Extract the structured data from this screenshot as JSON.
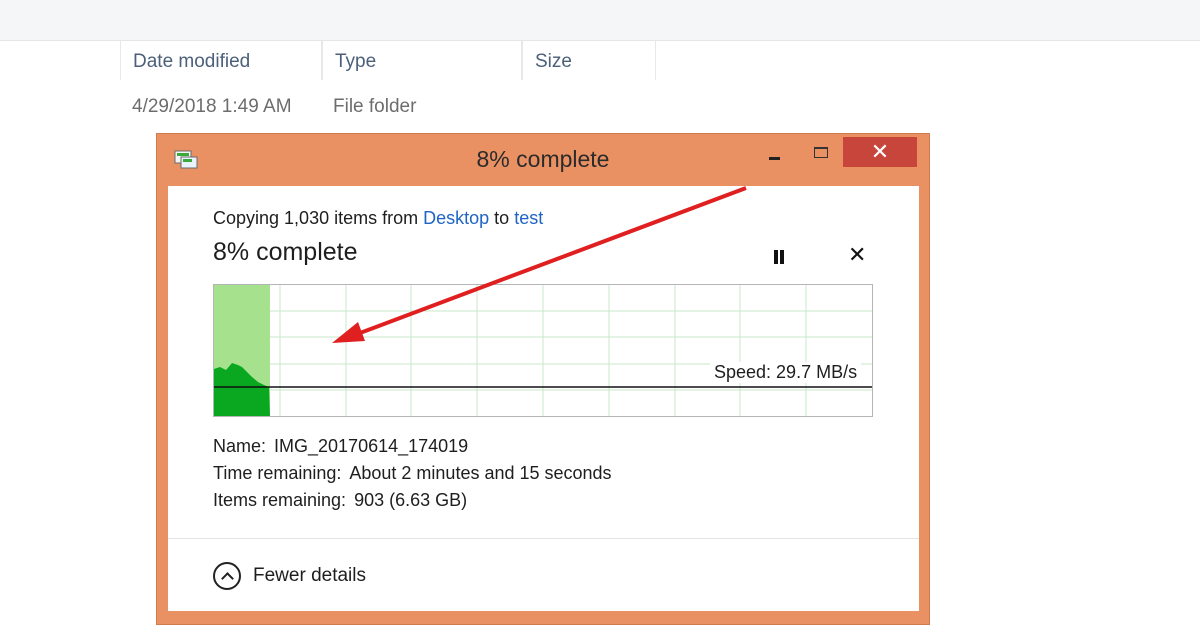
{
  "explorer": {
    "columns": [
      "Date modified",
      "Type",
      "Size"
    ],
    "row": {
      "date": "4/29/2018 1:49 AM",
      "type": "File folder",
      "size": ""
    }
  },
  "dialog": {
    "title": "8% complete",
    "minimize_icon": "minimize-icon",
    "maximize_icon": "maximize-icon",
    "close_icon": "close-icon",
    "close_label": "✕",
    "copy_prefix": "Copying 1,030 items from",
    "source": "Desktop",
    "to_word": "to",
    "destination": "test",
    "heading": "8% complete",
    "progress_fraction": 0.08,
    "speed": "Speed: 29.7 MB/s",
    "cancel_label": "✕",
    "name_label": "Name:",
    "name_value": "IMG_20170614_174019",
    "time_label": "Time remaining:",
    "time_value": "About 2 minutes and 15 seconds",
    "items_label": "Items remaining:",
    "items_value": "903 (6.63 GB)",
    "fewer_details": "Fewer details"
  },
  "colors": {
    "title_accent": "#e99163",
    "progress_light": "#a6e28e",
    "progress_dark": "#0aa820",
    "grid": "#c9e9c9",
    "annotation_arrow": "#e02020",
    "close_button": "#c8453b"
  }
}
